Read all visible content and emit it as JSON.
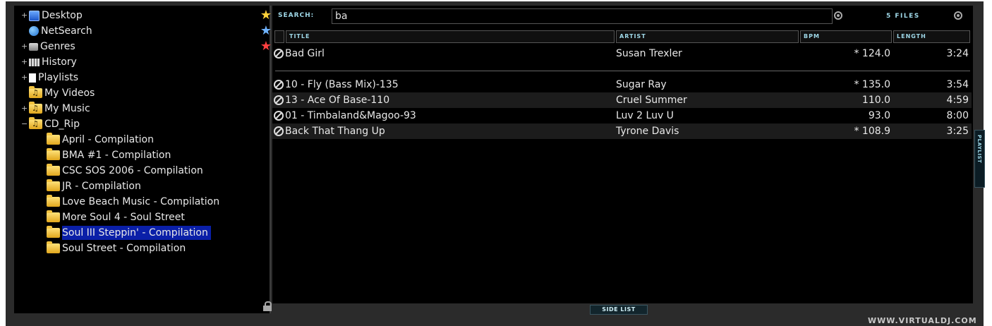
{
  "tree": {
    "items": [
      {
        "label": "Desktop",
        "expander": "+",
        "icon": "desktop-icon"
      },
      {
        "label": "NetSearch",
        "expander": "",
        "icon": "globe-icon"
      },
      {
        "label": "Genres",
        "expander": "+",
        "icon": "database-icon"
      },
      {
        "label": "History",
        "expander": "+",
        "icon": "history-icon"
      },
      {
        "label": "Playlists",
        "expander": "+",
        "icon": "document-icon"
      },
      {
        "label": "My Videos",
        "expander": "",
        "icon": "folder-music-icon"
      },
      {
        "label": "My Music",
        "expander": "+",
        "icon": "folder-music-icon"
      },
      {
        "label": "CD_Rip",
        "expander": "−",
        "icon": "folder-music-icon"
      },
      {
        "label": "April - Compilation"
      },
      {
        "label": "BMA #1 - Compilation"
      },
      {
        "label": "CSC SOS 2006 - Compilation"
      },
      {
        "label": "JR - Compilation"
      },
      {
        "label": "Love Beach Music - Compilation"
      },
      {
        "label": "More Soul 4 - Soul Street"
      },
      {
        "label": "Soul III Steppin' - Compilation"
      },
      {
        "label": "Soul Street - Compilation"
      }
    ],
    "selected": "Soul III Steppin' - Compilation"
  },
  "search": {
    "label": "SEARCH:",
    "value": "ba",
    "files_count": "5 FILES"
  },
  "columns": {
    "title": "TITLE",
    "artist": "ARTIST",
    "bpm": "BPM",
    "length": "LENGTH"
  },
  "rows": [
    {
      "title": "Bad Girl",
      "artist": "Susan Trexler",
      "bpm": "* 124.0",
      "length": "3:24"
    },
    {
      "title": "10 - Fly (Bass Mix)-135",
      "artist": "Sugar Ray",
      "bpm": "* 135.0",
      "length": "3:54"
    },
    {
      "title": "13 - Ace Of Base-110",
      "artist": "Cruel Summer",
      "bpm": "110.0",
      "length": "4:59"
    },
    {
      "title": "01 - Timbaland&Magoo-93",
      "artist": "Luv 2 Luv U",
      "bpm": "93.0",
      "length": "8:00"
    },
    {
      "title": "Back That Thang Up",
      "artist": "Tyrone Davis",
      "bpm": "* 108.9",
      "length": "3:25"
    }
  ],
  "playlist_tab": "PLAYLIST",
  "side_list_label": "SIDE LIST",
  "footer_url": "WWW.VIRTUALDJ.COM",
  "colors": {
    "accent": "#9fd8e8",
    "selection": "#0a1fa8",
    "background": "#000000",
    "frame": "#2b2b2b"
  }
}
